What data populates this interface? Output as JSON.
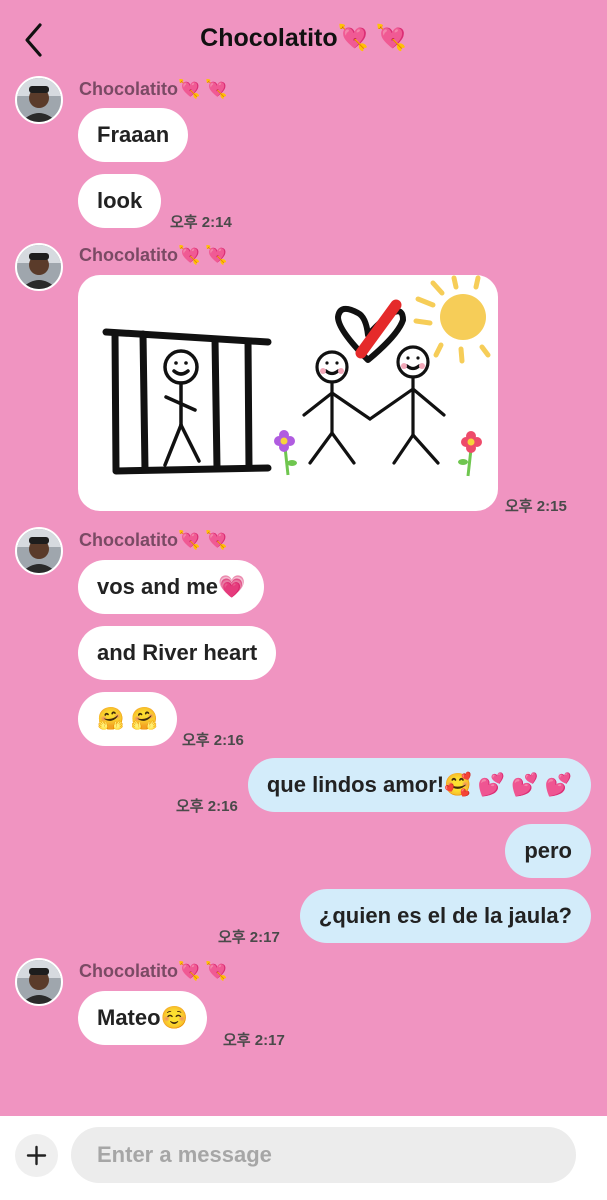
{
  "header": {
    "title": "Chocolatito💘 💘",
    "back_icon": "chevron-left-icon"
  },
  "groups": [
    {
      "sender": "Chocolatito💘 💘"
    },
    {
      "sender": "Chocolatito💘 💘"
    },
    {
      "sender": "Chocolatito💘 💘"
    },
    {
      "sender": "Chocolatito💘 💘"
    }
  ],
  "messages": [
    {
      "text": "Fraaan",
      "dir": "in"
    },
    {
      "text": "look",
      "dir": "in",
      "time": "오후 2:14"
    },
    {
      "text": "",
      "dir": "in",
      "type": "image",
      "time": "오후 2:15"
    },
    {
      "text": "vos and me💗",
      "dir": "in"
    },
    {
      "text": "and River heart",
      "dir": "in"
    },
    {
      "text": "🤗 🤗",
      "dir": "in",
      "time": "오후 2:16"
    },
    {
      "text": "que lindos amor!🥰 💕 💕 💕",
      "dir": "out",
      "time": "오후 2:16"
    },
    {
      "text": "pero",
      "dir": "out"
    },
    {
      "text": "¿quien es el de la jaula?",
      "dir": "out",
      "time": "오후 2:17"
    },
    {
      "text": "Mateo☺️",
      "dir": "in",
      "time": "오후 2:17"
    }
  ],
  "composer": {
    "placeholder": "Enter a message",
    "plus_icon": "plus-icon"
  },
  "colors": {
    "background": "#f094c1",
    "incoming_bubble": "#ffffff",
    "outgoing_bubble": "#d3ecfa",
    "sender_name": "#7a4a64"
  }
}
